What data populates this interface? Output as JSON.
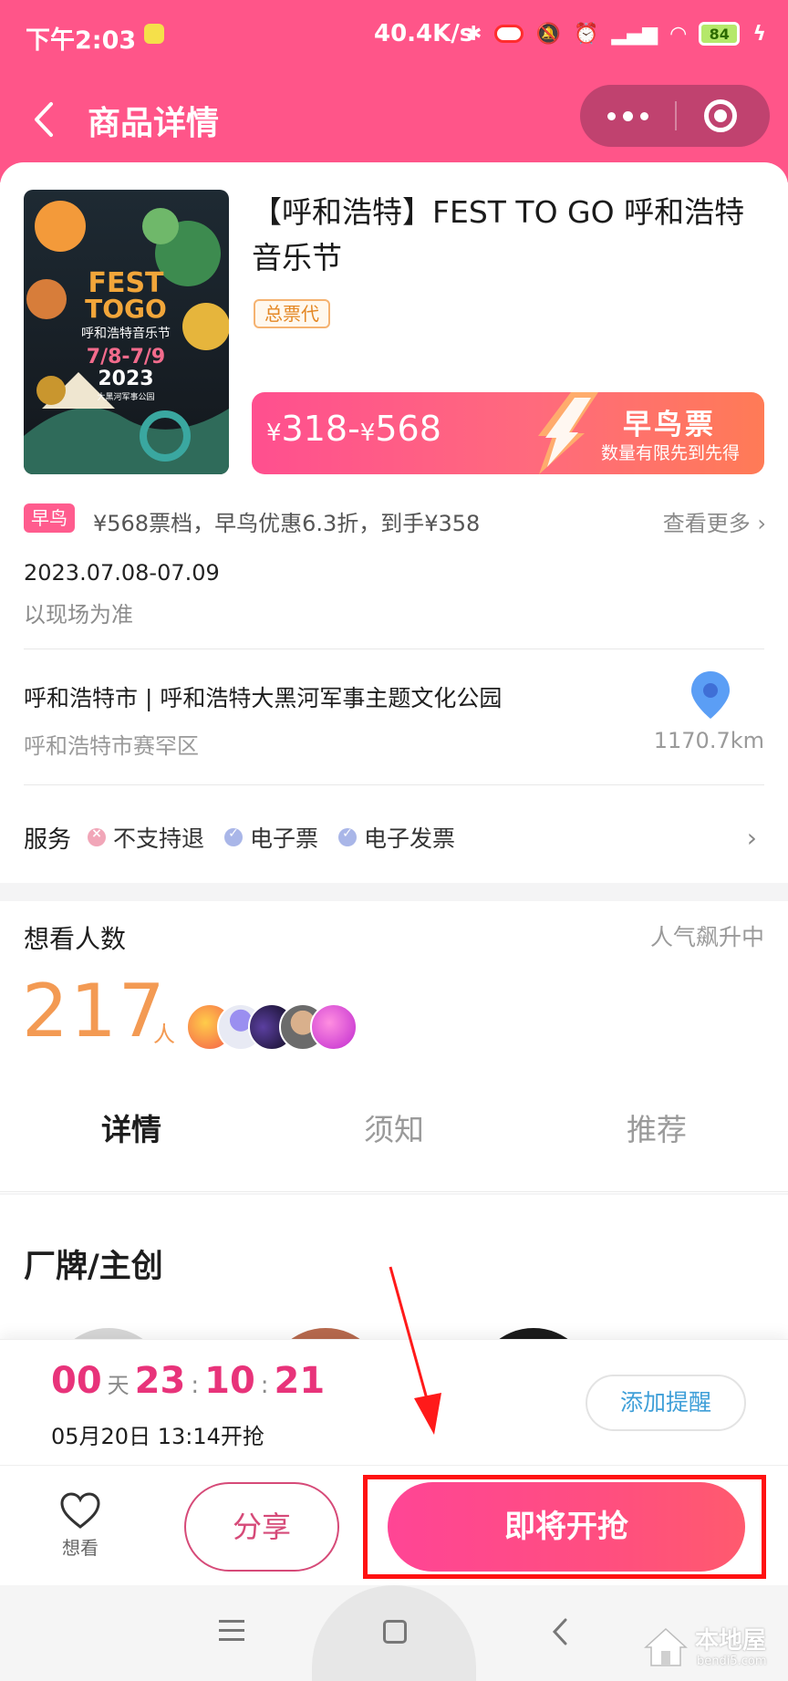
{
  "status_bar": {
    "time": "下午2:03",
    "network_speed": "40.4K/s",
    "battery": "84"
  },
  "header": {
    "title": "商品详情",
    "icons": [
      "back-arrow-icon",
      "more-dots-icon",
      "target-icon"
    ]
  },
  "product": {
    "title": "【呼和浩特】FEST TO GO 呼和浩特音乐节",
    "badge": "总票代",
    "poster": {
      "brand": "FEST",
      "brand2": "TOGO",
      "subtitle": "呼和浩特音乐节",
      "dates": "7/8-7/9",
      "year": "2023",
      "place": "大黑河军事公园"
    },
    "price_range": {
      "low_symbol": "¥",
      "low": "318",
      "dash": "-",
      "high_symbol": "¥",
      "high": "568"
    },
    "early_bird": {
      "title": "早鸟票",
      "subtitle": "数量有限先到先得"
    }
  },
  "promo": {
    "tag": "早鸟",
    "text": "¥568票档，早鸟优惠6.3折，到手¥358",
    "see_more": "查看更多 ›"
  },
  "schedule": {
    "date": "2023.07.08-07.09",
    "note": "以现场为准"
  },
  "venue": {
    "name": "呼和浩特市 | 呼和浩特大黑河军事主题文化公园",
    "district": "呼和浩特市赛罕区",
    "distance": "1170.7km"
  },
  "services": {
    "label": "服务",
    "items": [
      {
        "label": "不支持退",
        "status": "no"
      },
      {
        "label": "电子票",
        "status": "ok"
      },
      {
        "label": "电子发票",
        "status": "ok"
      }
    ]
  },
  "want": {
    "title": "想看人数",
    "trend": "人气飙升中",
    "count": "217",
    "unit": "人"
  },
  "tabs": [
    {
      "label": "详情",
      "active": true
    },
    {
      "label": "须知",
      "active": false
    },
    {
      "label": "推荐",
      "active": false
    }
  ],
  "section": {
    "title": "厂牌/主创"
  },
  "countdown": {
    "days": "00",
    "days_unit": "天",
    "hours": "23",
    "minutes": "10",
    "seconds": "21",
    "separator": ":",
    "open_time": "05月20日 13:14开抢",
    "remind_label": "添加提醒"
  },
  "actions": {
    "favorite_label": "想看",
    "share_label": "分享",
    "buy_label": "即将开抢"
  },
  "watermark": {
    "name": "本地屋",
    "site": "bendi5.com"
  },
  "colors": {
    "brand_pink": "#ff5589",
    "price_orange": "#f39a53",
    "countdown_pink": "#e8337a",
    "remind_blue": "#3f9fd8",
    "highlight_red": "#ff1111"
  }
}
